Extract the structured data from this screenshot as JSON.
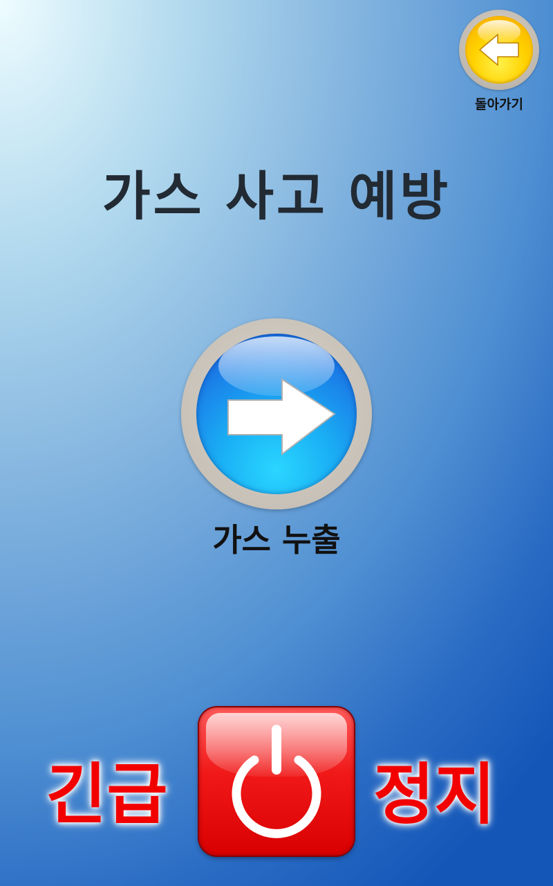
{
  "header": {
    "back_label": "돌아가기",
    "back_icon": "arrow-left-icon"
  },
  "page": {
    "title": "가스 사고 예방"
  },
  "main": {
    "gas_leak_label": "가스 누출",
    "gas_leak_icon": "arrow-right-icon"
  },
  "emergency": {
    "left_text": "긴급",
    "right_text": "정지",
    "icon": "power-icon",
    "color": "#f20000"
  }
}
